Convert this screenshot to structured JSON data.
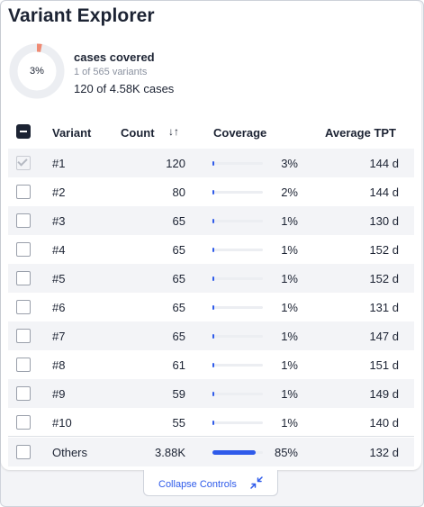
{
  "title": "Variant Explorer",
  "summary": {
    "donut_label": "3%",
    "donut_fraction": 0.03,
    "heading": "cases covered",
    "variants_line": "1 of 565 variants",
    "cases_line": "120 of 4.58K cases"
  },
  "table": {
    "headers": {
      "variant": "Variant",
      "count": "Count",
      "coverage": "Coverage",
      "tpt": "Average TPT"
    },
    "rows": [
      {
        "variant": "#1",
        "count": "120",
        "coverage": "3%",
        "coverage_fraction": 0.03,
        "tpt": "144 d",
        "checked": true
      },
      {
        "variant": "#2",
        "count": "80",
        "coverage": "2%",
        "coverage_fraction": 0.02,
        "tpt": "144 d",
        "checked": false
      },
      {
        "variant": "#3",
        "count": "65",
        "coverage": "1%",
        "coverage_fraction": 0.01,
        "tpt": "130 d",
        "checked": false
      },
      {
        "variant": "#4",
        "count": "65",
        "coverage": "1%",
        "coverage_fraction": 0.01,
        "tpt": "152 d",
        "checked": false
      },
      {
        "variant": "#5",
        "count": "65",
        "coverage": "1%",
        "coverage_fraction": 0.01,
        "tpt": "152 d",
        "checked": false
      },
      {
        "variant": "#6",
        "count": "65",
        "coverage": "1%",
        "coverage_fraction": 0.01,
        "tpt": "131 d",
        "checked": false
      },
      {
        "variant": "#7",
        "count": "65",
        "coverage": "1%",
        "coverage_fraction": 0.01,
        "tpt": "147 d",
        "checked": false
      },
      {
        "variant": "#8",
        "count": "61",
        "coverage": "1%",
        "coverage_fraction": 0.01,
        "tpt": "151 d",
        "checked": false
      },
      {
        "variant": "#9",
        "count": "59",
        "coverage": "1%",
        "coverage_fraction": 0.01,
        "tpt": "149 d",
        "checked": false
      },
      {
        "variant": "#10",
        "count": "55",
        "coverage": "1%",
        "coverage_fraction": 0.01,
        "tpt": "140 d",
        "checked": false
      }
    ],
    "others": {
      "variant": "Others",
      "count": "3.88K",
      "coverage": "85%",
      "coverage_fraction": 0.85,
      "tpt": "132 d",
      "checked": false
    }
  },
  "collapse_label": "Collapse Controls",
  "icons": {
    "sort": "sort-icon",
    "collapse": "collapse-arrows-icon"
  },
  "colors": {
    "accent": "#2f5bea",
    "donut_segment": "#ef8a73",
    "donut_track": "#eceef2",
    "text": "#1c2333"
  }
}
